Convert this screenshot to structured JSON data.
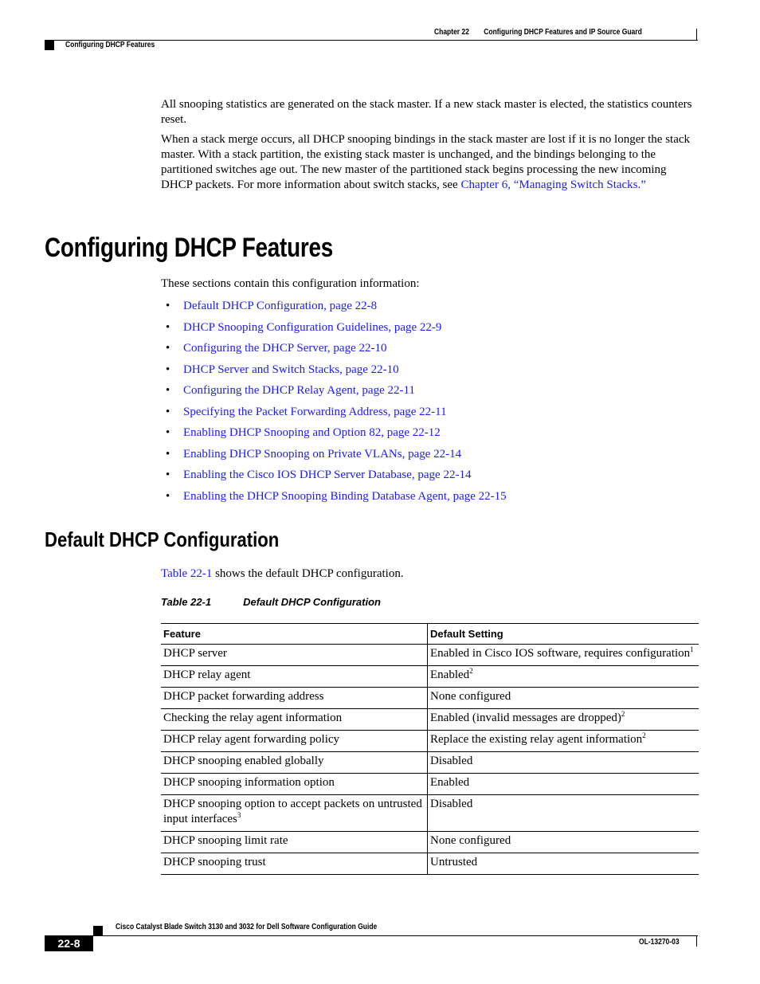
{
  "header": {
    "chapter": "Chapter 22",
    "chapter_title": "Configuring DHCP Features and IP Source Guard",
    "section": "Configuring DHCP Features"
  },
  "intro": {
    "para1": "All snooping statistics are generated on the stack master. If a new stack master is elected, the statistics counters reset.",
    "para2_text": "When a stack merge occurs, all DHCP snooping bindings in the stack master are lost if it is no longer the stack master. With a stack partition, the existing stack master is unchanged, and the bindings belonging to the partitioned switches age out. The new master of the partitioned stack begins processing the new incoming DHCP packets. For more information about switch stacks, see ",
    "para2_link": "Chapter 6, “Managing Switch Stacks.”"
  },
  "section_title": "Configuring DHCP Features",
  "sections_intro": "These sections contain this configuration information:",
  "toc": [
    "Default DHCP Configuration, page 22-8",
    "DHCP Snooping Configuration Guidelines, page 22-9",
    "Configuring the DHCP Server, page 22-10",
    "DHCP Server and Switch Stacks, page 22-10",
    "Configuring the DHCP Relay Agent, page 22-11",
    "Specifying the Packet Forwarding Address, page 22-11",
    "Enabling DHCP Snooping and Option 82, page 22-12",
    "Enabling DHCP Snooping on Private VLANs, page 22-14",
    "Enabling the Cisco IOS DHCP Server Database, page 22-14",
    "Enabling the DHCP Snooping Binding Database Agent, page 22-15"
  ],
  "subsection_title": "Default DHCP Configuration",
  "table_ref": {
    "link": "Table 22-1",
    "text": " shows the default DHCP configuration."
  },
  "table": {
    "caption_number": "Table 22-1",
    "caption_title": "Default DHCP Configuration",
    "columns": [
      "Feature",
      "Default Setting"
    ],
    "rows": [
      {
        "feature": "DHCP server",
        "feature_sup": "",
        "setting": "Enabled in Cisco IOS software, requires configuration",
        "setting_sup": "1"
      },
      {
        "feature": "DHCP relay agent",
        "feature_sup": "",
        "setting": "Enabled",
        "setting_sup": "2"
      },
      {
        "feature": "DHCP packet forwarding address",
        "feature_sup": "",
        "setting": "None configured",
        "setting_sup": ""
      },
      {
        "feature": "Checking the relay agent information",
        "feature_sup": "",
        "setting": "Enabled (invalid messages are dropped)",
        "setting_sup": "2"
      },
      {
        "feature": "DHCP relay agent forwarding policy",
        "feature_sup": "",
        "setting": "Replace the existing relay agent information",
        "setting_sup": "2"
      },
      {
        "feature": "DHCP snooping enabled globally",
        "feature_sup": "",
        "setting": "Disabled",
        "setting_sup": ""
      },
      {
        "feature": "DHCP snooping information option",
        "feature_sup": "",
        "setting": "Enabled",
        "setting_sup": ""
      },
      {
        "feature": "DHCP snooping option to accept packets on untrusted input interfaces",
        "feature_sup": "3",
        "setting": "Disabled",
        "setting_sup": ""
      },
      {
        "feature": "DHCP snooping limit rate",
        "feature_sup": "",
        "setting": "None configured",
        "setting_sup": ""
      },
      {
        "feature": "DHCP snooping trust",
        "feature_sup": "",
        "setting": "Untrusted",
        "setting_sup": ""
      }
    ]
  },
  "footer": {
    "guide_title": "Cisco Catalyst Blade Switch 3130 and 3032 for Dell Software Configuration Guide",
    "page_number": "22-8",
    "doc_number": "OL-13270-03"
  }
}
